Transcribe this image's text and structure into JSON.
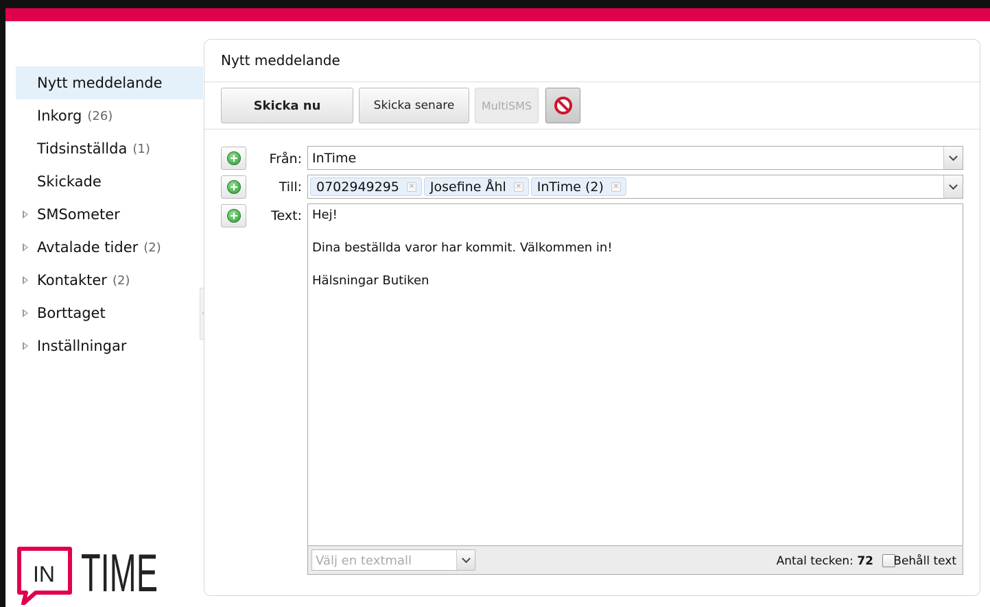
{
  "colors": {
    "brand": "#e0004d",
    "active_nav_bg": "#e4f0fa"
  },
  "sidebar": {
    "items": [
      {
        "label": "Nytt meddelande",
        "count": "",
        "expandable": false,
        "active": true
      },
      {
        "label": "Inkorg",
        "count": "(26)",
        "expandable": false,
        "active": false
      },
      {
        "label": "Tidsinställda",
        "count": "(1)",
        "expandable": false,
        "active": false
      },
      {
        "label": "Skickade",
        "count": "",
        "expandable": false,
        "active": false
      },
      {
        "label": "SMSometer",
        "count": "",
        "expandable": true,
        "active": false
      },
      {
        "label": "Avtalade tider",
        "count": "(2)",
        "expandable": true,
        "active": false
      },
      {
        "label": "Kontakter",
        "count": "(2)",
        "expandable": true,
        "active": false
      },
      {
        "label": "Borttaget",
        "count": "",
        "expandable": true,
        "active": false
      },
      {
        "label": "Inställningar",
        "count": "",
        "expandable": true,
        "active": false
      }
    ]
  },
  "logo": {
    "text_in": "IN",
    "text_time": "TIME"
  },
  "panel": {
    "title": "Nytt meddelande",
    "toolbar": {
      "send_now": "Skicka nu",
      "send_later": "Skicka senare",
      "multisms": "MultiSMS",
      "cancel_icon": "prohibited-icon"
    },
    "from": {
      "label": "Från:",
      "value": "InTime"
    },
    "to": {
      "label": "Till:",
      "recipients": [
        "0702949295",
        "Josefine Åhl",
        "InTime (2)"
      ]
    },
    "text": {
      "label": "Text:",
      "lines": [
        "Hej!",
        "Dina beställda varor har kommit. Välkommen in!",
        "Hälsningar Butiken"
      ]
    },
    "template_placeholder": "Välj en textmall",
    "char_count_label": "Antal tecken:",
    "char_count": "72",
    "keep_text_label": "Behåll text"
  }
}
